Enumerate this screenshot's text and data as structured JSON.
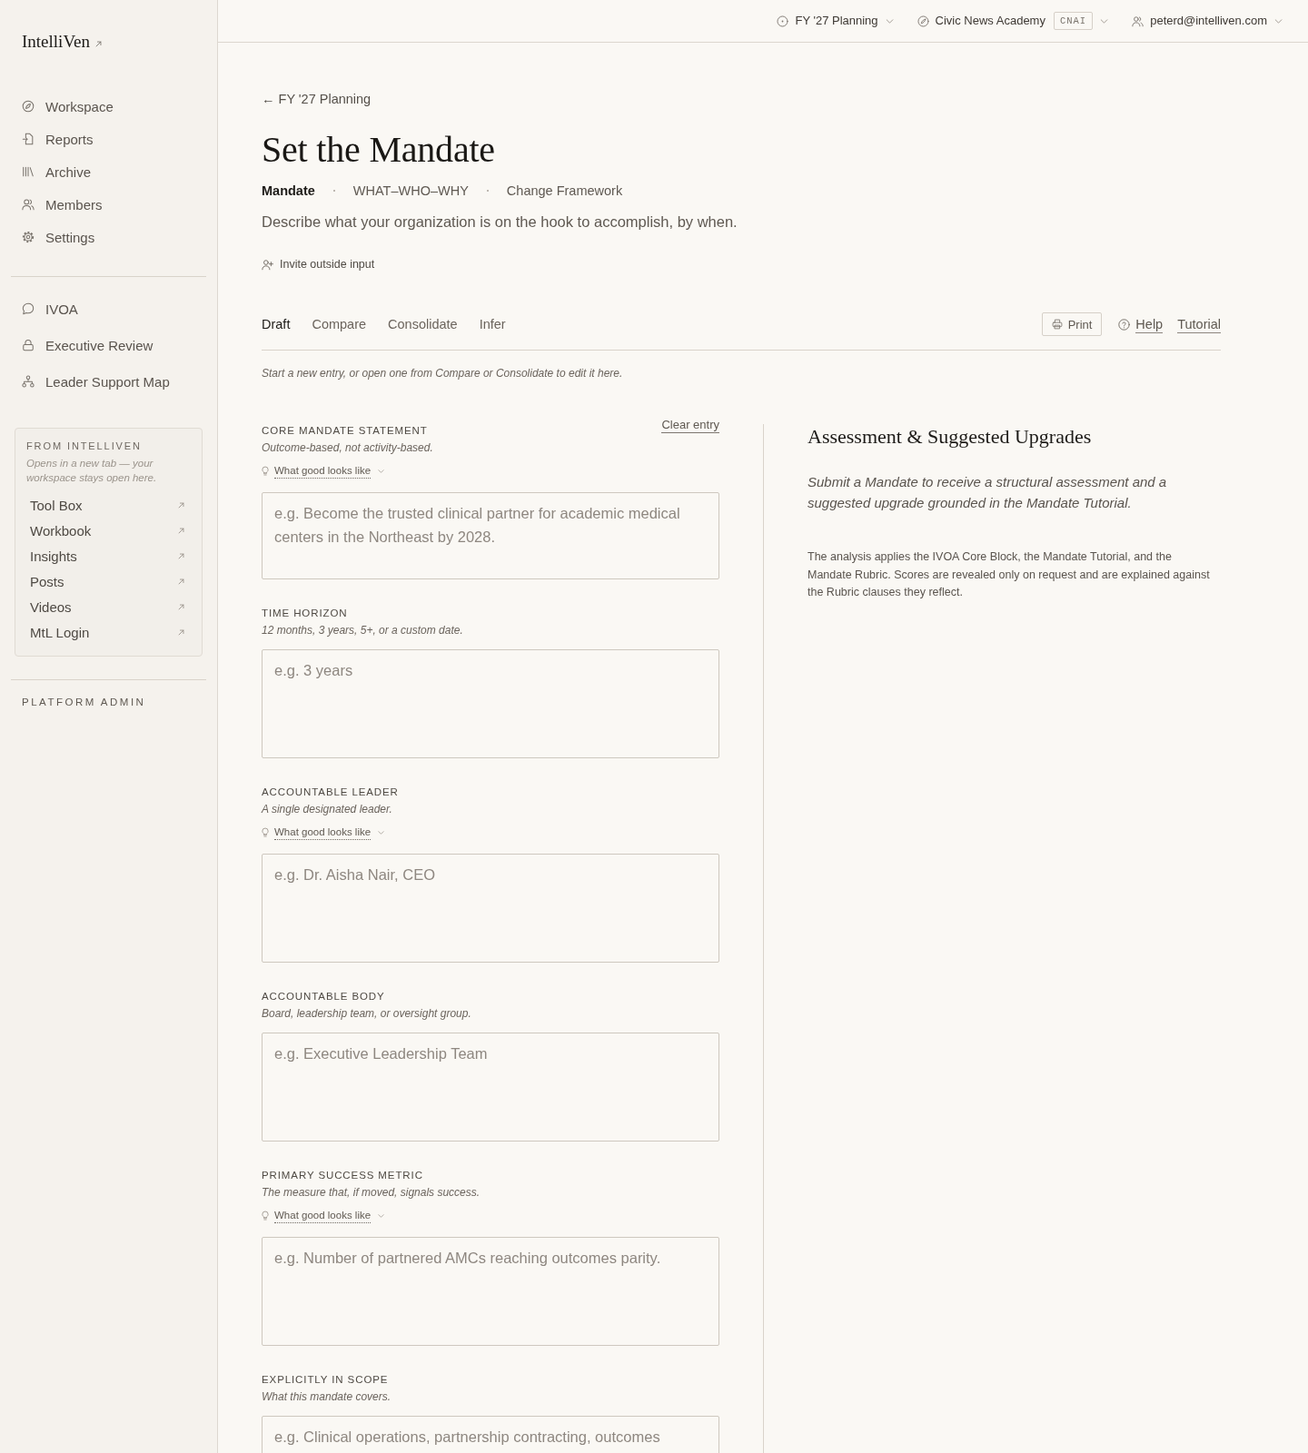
{
  "sidebar": {
    "logo": "IntelliVen",
    "nav_items": [
      {
        "label": "Workspace",
        "selected": false
      },
      {
        "label": "Reports",
        "selected": false
      },
      {
        "label": "Archive",
        "selected": false
      },
      {
        "label": "Members",
        "selected": false
      },
      {
        "label": "Settings",
        "selected": false
      }
    ],
    "tool_items": [
      {
        "label": "IVOA",
        "selected": false
      },
      {
        "label": "Executive Review",
        "selected": false
      },
      {
        "label": "Leader Support Map",
        "selected": false
      }
    ],
    "external": {
      "heading": "FROM INTELLIVEN",
      "note": "Opens in a new tab — your workspace stays open here.",
      "links": [
        "Tool Box",
        "Workbook",
        "Insights",
        "Posts",
        "Videos",
        "MtL Login"
      ]
    },
    "admin_heading": "PLATFORM ADMIN"
  },
  "top_bar": {
    "plan": "FY '27 Planning",
    "organization": {
      "name": "Civic News Academy",
      "code": "CNAI"
    },
    "account": "peterd@intelliven.com"
  },
  "page": {
    "back_link": "← FY '27 Planning",
    "title": "Set the Mandate",
    "breadcrumbs": [
      {
        "label": "Mandate",
        "selected": true
      },
      {
        "label": "WHAT–WHO–WHY",
        "selected": false
      },
      {
        "label": "Change Framework",
        "selected": false
      }
    ],
    "description": "Describe what your organization is on the hook to accomplish, by when.",
    "invite": "Invite outside input"
  },
  "tabs": [
    {
      "label": "Draft",
      "selected": true
    },
    {
      "label": "Compare",
      "selected": false
    },
    {
      "label": "Consolidate",
      "selected": false
    },
    {
      "label": "Infer",
      "selected": false
    }
  ],
  "tab_actions": {
    "print": "Print",
    "help": "Help",
    "tutorial": "Tutorial"
  },
  "draft_hint": "Start a new entry, or open one from Compare or Consolidate to edit it here.",
  "form": {
    "fields": [
      {
        "label": "CORE MANDATE STATEMENT",
        "action": "Clear entry",
        "hint": "Outcome-based, not activity-based.",
        "guide": "What good looks like",
        "placeholder": "e.g. Become the trusted clinical partner for academic medical centers in the Northeast by 2028."
      },
      {
        "label": "TIME HORIZON",
        "hint": "12 months, 3 years, 5+, or a custom date.",
        "placeholder": "e.g. 3 years"
      },
      {
        "label": "ACCOUNTABLE LEADER",
        "hint": "A single designated leader.",
        "guide": "What good looks like",
        "placeholder": "e.g. Dr. Aisha Nair, CEO"
      },
      {
        "label": "ACCOUNTABLE BODY",
        "hint": "Board, leadership team, or oversight group.",
        "placeholder": "e.g. Executive Leadership Team"
      },
      {
        "label": "PRIMARY SUCCESS METRIC",
        "hint": "The measure that, if moved, signals success.",
        "guide": "What good looks like",
        "placeholder": "e.g. Number of partnered AMCs reaching outcomes parity."
      },
      {
        "label": "EXPLICITLY IN SCOPE",
        "hint": "What this mandate covers.",
        "placeholder": "e.g. Clinical operations, partnership contracting, outcomes"
      }
    ]
  },
  "assessment": {
    "title": "Assessment & Suggested Upgrades",
    "intro": "Submit a Mandate to receive a structural assessment and a suggested upgrade grounded in the Mandate Tutorial.",
    "note": "The analysis applies the IVOA Core Block, the Mandate Tutorial, and the Mandate Rubric. Scores are revealed only on request and are explained against the Rubric clauses they reflect."
  }
}
